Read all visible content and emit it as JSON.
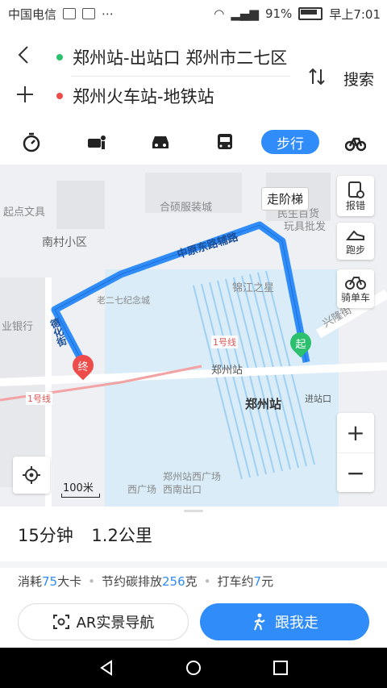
{
  "statusbar": {
    "carrier": "中国电信",
    "icons": "⋯",
    "battery_pct": "91%",
    "time": "早上7:01"
  },
  "route": {
    "start": "郑州站-出站口 郑州市二七区",
    "end": "郑州火车站-地铁站",
    "search_label": "搜索",
    "start_color": "#2bbf6e",
    "end_color": "#ee4b4b"
  },
  "modes": {
    "active": "步行",
    "items": [
      "timer-icon",
      "taxi-icon",
      "car-icon",
      "bus-icon",
      "walk",
      "bike-icon"
    ]
  },
  "map": {
    "labels": {
      "qidian": "起点文具",
      "nancun": "南村小区",
      "hefu": "合硕服装城",
      "zhongyuan": "中原东路辅路",
      "wenju": "玩具批发",
      "minsheng": "民生百货",
      "jinjiang": "锦江之星",
      "xinglong": "兴隆街",
      "bank": "业银行",
      "laoerqi": "老二七纪念城",
      "metro_line": "1号线",
      "metro_line2": "1号线",
      "zhengzhou_station_label": "郑州站",
      "zhengzhou_station_big": "郑州站",
      "jinzhan": "进站口",
      "xiguangchang": "西广场",
      "westplaza": "郑州站西广场",
      "westplaza2": "西南出口",
      "street_label": "德化街",
      "start_marker": "起",
      "end_marker": "终"
    },
    "stairs_tag": "走阶梯",
    "report_label": "报错",
    "running_label": "跑步",
    "bike_label": "骑单车",
    "scale_label": "100米",
    "route_color": "#2f8cf8"
  },
  "summary": {
    "duration": "15分钟",
    "distance": "1.2公里",
    "calories_prefix": "消耗",
    "calories_value": "75",
    "calories_unit": "大卡",
    "carbon_prefix": "节约碳排放",
    "carbon_value": "256",
    "carbon_unit": "克",
    "taxi_prefix": "打车约",
    "taxi_value": "7",
    "taxi_unit": "元"
  },
  "buttons": {
    "ar_label": "AR实景导航",
    "follow_label": "跟我走"
  }
}
